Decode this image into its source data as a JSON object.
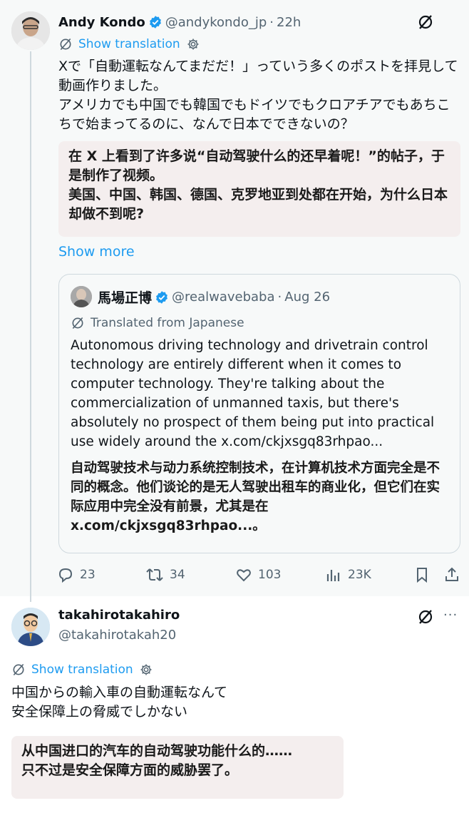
{
  "post1": {
    "name": "Andy Kondo",
    "handle": "@andykondo_jp",
    "time": "22h",
    "show_translation": "Show translation",
    "text": "Xで「自動運転なんてまだだ！」っていう多くのポストを拝見して動画作りました。\nアメリカでも中国でも韓国でもドイツでもクロアチアでもあちこちで始まってるのに、なんで日本でできないの？",
    "translation": "在 X 上看到了许多说“自动驾驶什么的还早着呢！”的帖子，于是制作了视频。\n美国、中国、韩国、德国、克罗地亚到处都在开始，为什么日本却做不到呢?",
    "show_more": "Show more",
    "quote": {
      "name": "馬場正博",
      "handle": "@realwavebaba",
      "time": "Aug 26",
      "translated_from": "Translated from Japanese",
      "text": "Autonomous driving technology and drivetrain control technology are entirely different when it comes to computer technology. They're talking about the commercialization of unmanned taxis, but there's absolutely no prospect of them being put into practical use widely around the x.com/ckjxsgq83rhpao...",
      "translation": "自动驾驶技术与动力系统控制技术，在计算机技术方面完全是不同的概念。他们谈论的是无人驾驶出租车的商业化，但它们在实际应用中完全没有前景，尤其是在 x.com/ckjxsgq83rhpao...。"
    },
    "actions": {
      "replies": "23",
      "reposts": "34",
      "likes": "103",
      "views": "23K"
    }
  },
  "post2": {
    "name": "takahirotakahiro",
    "handle": "@takahirotakah20",
    "show_translation": "Show translation",
    "text": "中国からの輸入車の自動運転なんて\n安全保障上の脅威でしかない",
    "translation": "从中国进口的汽车的自动驾驶功能什么的……\n只不过是安全保障方面的威胁罢了。"
  },
  "colors": {
    "accent": "#1d9bf0",
    "secondary_text": "#536471",
    "translation_bg": "#f4eeee"
  }
}
